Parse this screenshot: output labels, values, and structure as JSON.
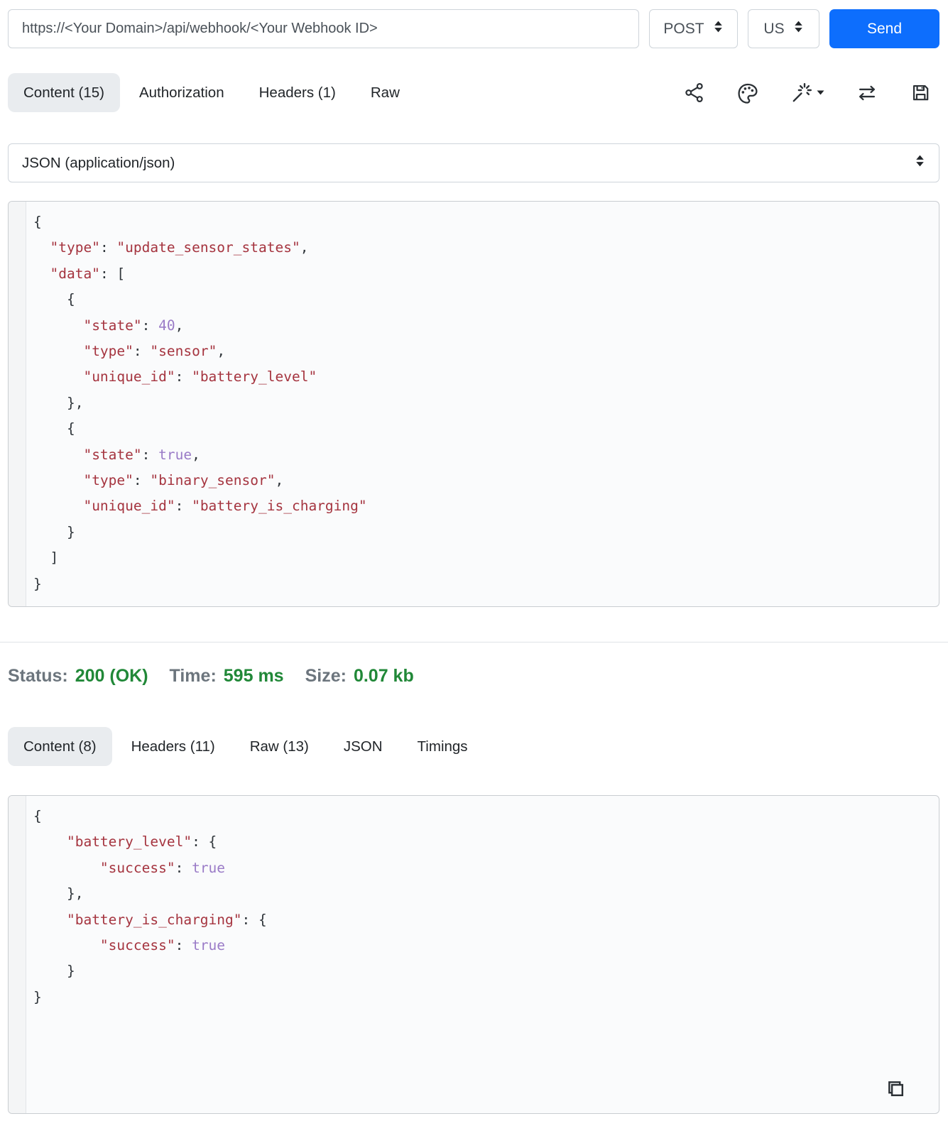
{
  "request_bar": {
    "url": "https://<Your Domain>/api/webhook/<Your Webhook ID>",
    "method": "POST",
    "region": "US",
    "send_label": "Send"
  },
  "request_tabs": {
    "content": "Content (15)",
    "authorization": "Authorization",
    "headers": "Headers (1)",
    "raw": "Raw"
  },
  "toolbar": {
    "icons": [
      "share-icon",
      "palette-icon",
      "magic-wand-icon",
      "swap-arrows-icon",
      "save-icon"
    ]
  },
  "body_type_select": {
    "value": "JSON (application/json)"
  },
  "request_body": {
    "lines": [
      [
        [
          "p",
          "{"
        ]
      ],
      [
        [
          "p",
          "  "
        ],
        [
          "s",
          "\"type\""
        ],
        [
          "p",
          ": "
        ],
        [
          "s",
          "\"update_sensor_states\""
        ],
        [
          "p",
          ","
        ]
      ],
      [
        [
          "p",
          "  "
        ],
        [
          "s",
          "\"data\""
        ],
        [
          "p",
          ": ["
        ]
      ],
      [
        [
          "p",
          "    {"
        ]
      ],
      [
        [
          "p",
          "      "
        ],
        [
          "s",
          "\"state\""
        ],
        [
          "p",
          ": "
        ],
        [
          "n",
          "40"
        ],
        [
          "p",
          ","
        ]
      ],
      [
        [
          "p",
          "      "
        ],
        [
          "s",
          "\"type\""
        ],
        [
          "p",
          ": "
        ],
        [
          "s",
          "\"sensor\""
        ],
        [
          "p",
          ","
        ]
      ],
      [
        [
          "p",
          "      "
        ],
        [
          "s",
          "\"unique_id\""
        ],
        [
          "p",
          ": "
        ],
        [
          "s",
          "\"battery_level\""
        ]
      ],
      [
        [
          "p",
          "    },"
        ]
      ],
      [
        [
          "p",
          "    {"
        ]
      ],
      [
        [
          "p",
          "      "
        ],
        [
          "s",
          "\"state\""
        ],
        [
          "p",
          ": "
        ],
        [
          "n",
          "true"
        ],
        [
          "p",
          ","
        ]
      ],
      [
        [
          "p",
          "      "
        ],
        [
          "s",
          "\"type\""
        ],
        [
          "p",
          ": "
        ],
        [
          "s",
          "\"binary_sensor\""
        ],
        [
          "p",
          ","
        ]
      ],
      [
        [
          "p",
          "      "
        ],
        [
          "s",
          "\"unique_id\""
        ],
        [
          "p",
          ": "
        ],
        [
          "s",
          "\"battery_is_charging\""
        ]
      ],
      [
        [
          "p",
          "    }"
        ]
      ],
      [
        [
          "p",
          "  ]"
        ]
      ],
      [
        [
          "p",
          "}"
        ]
      ]
    ]
  },
  "status_bar": {
    "status_label": "Status:",
    "status_value": "200 (OK)",
    "time_label": "Time:",
    "time_value": "595 ms",
    "size_label": "Size:",
    "size_value": "0.07 kb"
  },
  "response_tabs": {
    "content": "Content (8)",
    "headers": "Headers (11)",
    "raw": "Raw (13)",
    "json": "JSON",
    "timings": "Timings"
  },
  "response_body": {
    "lines": [
      [
        [
          "p",
          "{"
        ]
      ],
      [
        [
          "p",
          "    "
        ],
        [
          "s",
          "\"battery_level\""
        ],
        [
          "p",
          ": {"
        ]
      ],
      [
        [
          "p",
          "        "
        ],
        [
          "s",
          "\"success\""
        ],
        [
          "p",
          ": "
        ],
        [
          "n",
          "true"
        ]
      ],
      [
        [
          "p",
          "    },"
        ]
      ],
      [
        [
          "p",
          "    "
        ],
        [
          "s",
          "\"battery_is_charging\""
        ],
        [
          "p",
          ": {"
        ]
      ],
      [
        [
          "p",
          "        "
        ],
        [
          "s",
          "\"success\""
        ],
        [
          "p",
          ": "
        ],
        [
          "n",
          "true"
        ]
      ],
      [
        [
          "p",
          "    }"
        ]
      ],
      [
        [
          "p",
          "}"
        ]
      ]
    ]
  },
  "colors": {
    "accent": "#0d6efd",
    "success": "#218838",
    "muted": "#6c757d",
    "string": "#a5343f",
    "literal": "#9a7bc7",
    "plain": "#2f353a"
  }
}
